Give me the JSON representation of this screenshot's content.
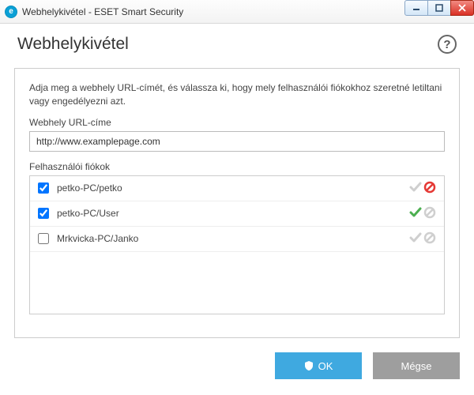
{
  "window": {
    "title": "Webhelykivétel - ESET Smart Security",
    "app_icon_letter": "e"
  },
  "header": {
    "title": "Webhelykivétel"
  },
  "content": {
    "intro": "Adja meg a webhely URL-címét, és válassza ki, hogy mely felhasználói fiókokhoz szeretné letiltani vagy engedélyezni azt.",
    "url_label": "Webhely URL-címe",
    "url_value": "http://www.examplepage.com",
    "accounts_label": "Felhasználói fiókok",
    "accounts": [
      {
        "name": "petko-PC/petko",
        "checked": true,
        "allow": "inactive",
        "block": "active"
      },
      {
        "name": "petko-PC/User",
        "checked": true,
        "allow": "active",
        "block": "inactive"
      },
      {
        "name": "Mrkvicka-PC/Janko",
        "checked": false,
        "allow": "inactive",
        "block": "inactive"
      }
    ]
  },
  "footer": {
    "ok_label": "OK",
    "cancel_label": "Mégse"
  }
}
